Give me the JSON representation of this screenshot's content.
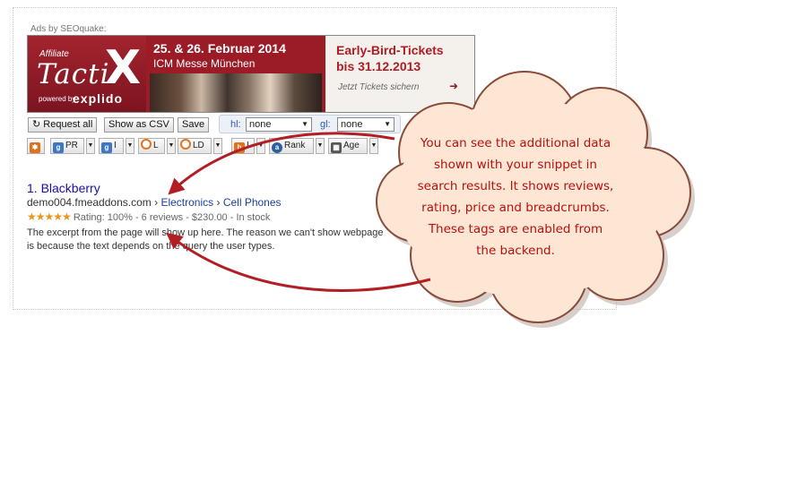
{
  "ads_label": "Ads by SEOquake:",
  "banner": {
    "logo_small": "Affiliate",
    "logo_big": "Tacti",
    "logo_x": "X",
    "logo_powered": "powered by",
    "logo_brand": "explido",
    "event_date": "25. & 26. Februar 2014",
    "event_venue": "ICM Messe München",
    "early_line1": "Early-Bird-Tickets",
    "early_line2": "bis 31.12.2013",
    "cta": "Jetzt Tickets sichern"
  },
  "toolbar": {
    "request_all": "Request all",
    "show_csv": "Show as CSV",
    "save": "Save",
    "hl_label": "hl:",
    "hl_value": "none",
    "gl_label": "gl:",
    "gl_value": "none"
  },
  "metrics": {
    "pr": "PR",
    "i1": "I",
    "l": "L",
    "ld": "LD",
    "i2": "I",
    "rank": "Rank",
    "age": "Age"
  },
  "result": {
    "title": "1. Blackberry",
    "domain": "demo004.fmeaddons.com",
    "sep": "›",
    "crumb1": "Electronics",
    "crumb2": "Cell Phones",
    "stars": "★★★★★",
    "rating": "Rating: 100% - 6 reviews - $230.00 - In stock",
    "snippet": "The excerpt from the page will show up here. The reason we can't show webpage is because the text depends on the query the user types."
  },
  "callout": {
    "text": "You can see the additional data shown with your snippet in search results. It shows reviews, rating, price and breadcrumbs. These tags are enabled from the backend."
  },
  "colors": {
    "callout_text": "#b80f0f",
    "callout_stroke": "#8a4a3a",
    "callout_fill": "#fde7d4",
    "arrow": "#b21e24",
    "link": "#1a0dab",
    "star": "#e7971b"
  }
}
